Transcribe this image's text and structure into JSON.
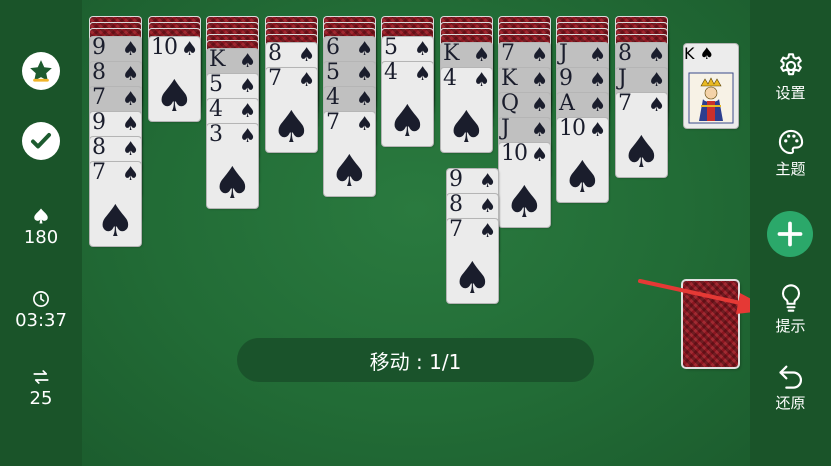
{
  "left_bar": {
    "star_icon": "star-icon",
    "check_icon": "checkmark-icon",
    "score": "180",
    "time": "03:37",
    "moves": "25"
  },
  "right_bar": {
    "settings_label": "设置",
    "theme_label": "主题",
    "hint_label": "提示",
    "undo_label": "还原"
  },
  "move_status": "移动 : 1/1",
  "completed_foundation": {
    "rank": "K",
    "suit": "♠"
  },
  "columns": [
    {
      "backs": 3,
      "cards": [
        {
          "r": "9",
          "dim": true
        },
        {
          "r": "8",
          "dim": true
        },
        {
          "r": "7",
          "dim": true
        },
        {
          "r": "9",
          "dim": false
        },
        {
          "r": "8",
          "dim": false
        },
        {
          "r": "7",
          "dim": false
        }
      ]
    },
    {
      "backs": 3,
      "cards": [
        {
          "r": "10",
          "dim": false
        }
      ]
    },
    {
      "backs": 5,
      "cards": [
        {
          "r": "K",
          "dim": true
        },
        {
          "r": "5",
          "dim": false
        },
        {
          "r": "4",
          "dim": false
        },
        {
          "r": "3",
          "dim": false
        }
      ]
    },
    {
      "backs": 4,
      "cards": [
        {
          "r": "8",
          "dim": false
        },
        {
          "r": "7",
          "dim": false
        }
      ]
    },
    {
      "backs": 3,
      "cards": [
        {
          "r": "6",
          "dim": true
        },
        {
          "r": "5",
          "dim": true
        },
        {
          "r": "4",
          "dim": true
        },
        {
          "r": "7",
          "dim": false
        }
      ]
    },
    {
      "backs": 3,
      "cards": [
        {
          "r": "5",
          "dim": false
        },
        {
          "r": "4",
          "dim": false
        }
      ]
    },
    {
      "backs": 4,
      "cards": [
        {
          "r": "K",
          "dim": true
        },
        {
          "r": "4",
          "dim": false
        }
      ]
    },
    {
      "backs": 4,
      "cards": [
        {
          "r": "7",
          "dim": true
        },
        {
          "r": "K",
          "dim": true
        },
        {
          "r": "Q",
          "dim": true
        },
        {
          "r": "J",
          "dim": true
        },
        {
          "r": "10",
          "dim": false
        }
      ]
    },
    {
      "backs": 4,
      "cards": [
        {
          "r": "J",
          "dim": true
        },
        {
          "r": "9",
          "dim": true
        },
        {
          "r": "A",
          "dim": true
        },
        {
          "r": "10",
          "dim": false
        }
      ]
    },
    {
      "backs": 4,
      "cards": [
        {
          "r": "8",
          "dim": true
        },
        {
          "r": "J",
          "dim": true
        },
        {
          "r": "7",
          "dim": false
        }
      ]
    }
  ],
  "floating_stack": [
    {
      "r": "9"
    },
    {
      "r": "8"
    },
    {
      "r": "7"
    }
  ],
  "colors": {
    "felt": "#226c36",
    "sidebar": "#1a5429",
    "card_back": "#8a1620",
    "add_button": "#2ba86a",
    "arrow": "#e53935"
  }
}
